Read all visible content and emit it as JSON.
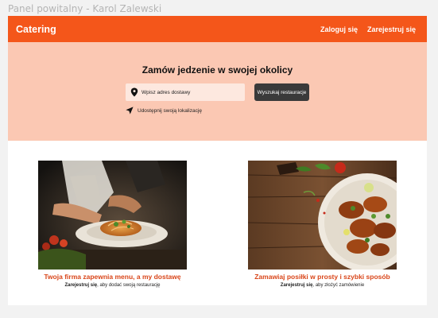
{
  "window": {
    "frame_title": "Panel powitalny - Karol Zalewski"
  },
  "navbar": {
    "brand": "Catering",
    "login_label": "Zaloguj się",
    "register_label": "Zarejestruj się"
  },
  "hero": {
    "title": "Zamów jedzenie w swojej okolicy",
    "address_placeholder": "Wpisz adres dostawy",
    "search_label": "Wyszukaj restauracje",
    "share_location_label": "Udostępnij swoją lokalizację"
  },
  "cards": [
    {
      "image_icon": "chef-plating-pasta-photo",
      "title": "Twoja firma zapewnia menu, a my dostawę",
      "link": "Zarejestruj się",
      "rest": ", aby dodać swoją restaurację"
    },
    {
      "image_icon": "grilled-chicken-bowl-photo",
      "title": "Zamawiaj posiłki w prosty i szybki sposób",
      "link": "Zarejestruj się",
      "rest": ", aby złożyć zamówienie"
    }
  ],
  "colors": {
    "accent": "#f4561a",
    "hero_bg": "#fbc8b3",
    "card_title": "#d9461a",
    "button_dark": "#3a3a3a"
  }
}
